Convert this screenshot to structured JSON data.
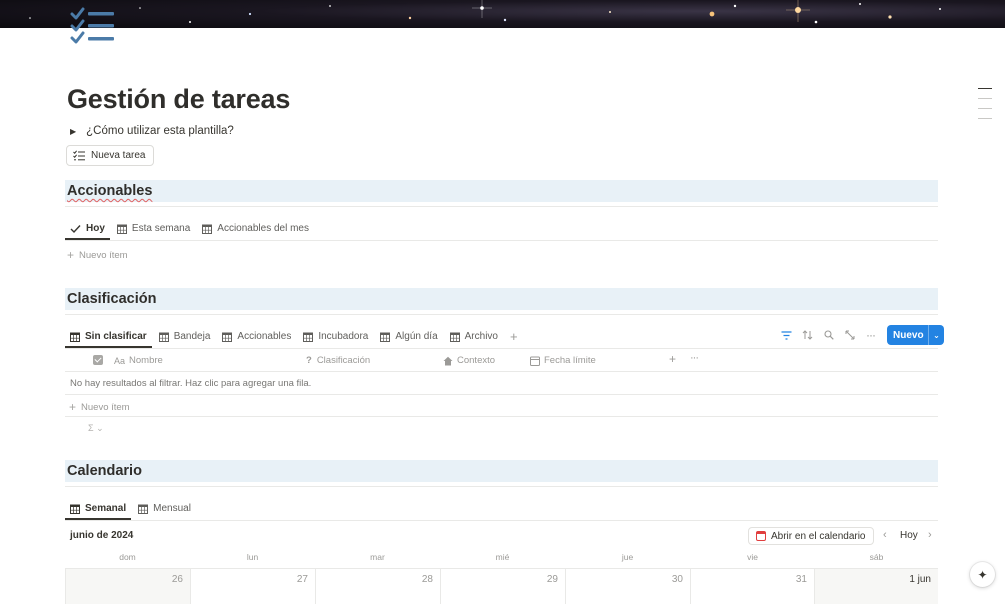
{
  "page": {
    "title": "Gestión de tareas",
    "icon": "checklist-icon",
    "toggle_label": "¿Cómo utilizar esta plantilla?",
    "new_task_button": "Nueva tarea"
  },
  "accionables": {
    "heading": "Accionables",
    "tabs": [
      {
        "label": "Hoy",
        "icon": "check-icon",
        "active": true
      },
      {
        "label": "Esta semana",
        "icon": "calendar-icon"
      },
      {
        "label": "Accionables del mes",
        "icon": "calendar-icon"
      }
    ],
    "new_item": "Nuevo ítem"
  },
  "clasificacion": {
    "heading": "Clasificación",
    "tabs": [
      {
        "label": "Sin clasificar",
        "icon": "table-icon",
        "active": true
      },
      {
        "label": "Bandeja",
        "icon": "table-icon"
      },
      {
        "label": "Accionables",
        "icon": "table-icon"
      },
      {
        "label": "Incubadora",
        "icon": "table-icon"
      },
      {
        "label": "Algún día",
        "icon": "table-icon"
      },
      {
        "label": "Archivo",
        "icon": "table-icon"
      }
    ],
    "new_button": "Nuevo",
    "columns": [
      "Nombre",
      "Clasificación",
      "Contexto",
      "Fecha límite"
    ],
    "empty_message": "No hay resultados al filtrar. Haz clic para agregar una fila.",
    "new_item": "Nuevo ítem",
    "sum_symbol": "Σ ⌄"
  },
  "calendario": {
    "heading": "Calendario",
    "tabs": [
      {
        "label": "Semanal",
        "icon": "calendar-icon",
        "active": true
      },
      {
        "label": "Mensual",
        "icon": "calendar-icon"
      }
    ],
    "month": "junio de 2024",
    "open_button": "Abrir en el calendario",
    "today_label": "Hoy",
    "weekdays": [
      "dom",
      "lun",
      "mar",
      "mié",
      "jue",
      "vie",
      "sáb"
    ],
    "days": [
      "26",
      "27",
      "28",
      "29",
      "30",
      "31",
      "1 jun"
    ]
  },
  "colors": {
    "accent": "#2383e2",
    "heading_bg": "#e8f1f7",
    "icon_blue": "#4b7ba8"
  }
}
